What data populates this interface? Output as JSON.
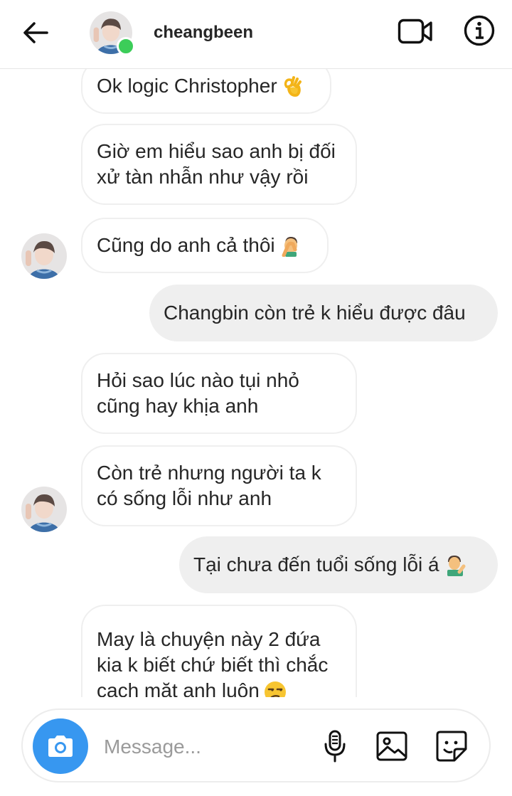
{
  "header": {
    "username": "cheangbeen",
    "back_icon": "arrow-left-icon",
    "video_icon": "video-camera-icon",
    "info_icon": "info-icon",
    "online_color": "#3ccd59"
  },
  "messages": [
    {
      "side": "in",
      "text": "Ok logic Christopher",
      "emoji": "ok-hand"
    },
    {
      "side": "in",
      "text": "Giờ em hiểu sao anh bị đối\nxử tàn nhẫn như vậy rồi"
    },
    {
      "side": "in",
      "text": "Cũng do anh cả thôi",
      "emoji": "facepalm"
    },
    {
      "side": "out",
      "text": "Changbin còn trẻ k hiểu được đâu"
    },
    {
      "side": "in",
      "text": "Hỏi sao lúc nào tụi nhỏ\ncũng hay khịa anh"
    },
    {
      "side": "in",
      "text": "Còn trẻ nhưng người ta k\ncó sống lỗi như anh"
    },
    {
      "side": "out",
      "text": "Tại chưa đến tuổi sống lỗi á",
      "emoji": "tipping-hand"
    },
    {
      "side": "in",
      "text": "May là chuyện này 2 đứa\nkia k biết chứ biết thì chắc\ncạch mặt anh luôn",
      "emoji": "unamused"
    }
  ],
  "composer": {
    "placeholder": "Message...",
    "camera_icon": "camera-icon",
    "mic_icon": "microphone-icon",
    "gallery_icon": "image-icon",
    "sticker_icon": "sticker-icon",
    "accent_color": "#3797f0"
  }
}
